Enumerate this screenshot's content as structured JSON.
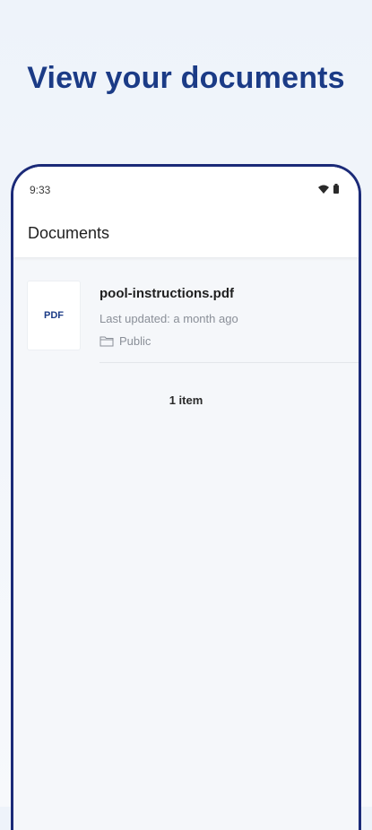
{
  "headline": "View your documents",
  "status_bar": {
    "time": "9:33",
    "wifi_icon": "wifi-icon",
    "battery_icon": "battery-icon"
  },
  "app_bar": {
    "title": "Documents"
  },
  "documents": [
    {
      "thumb_label": "PDF",
      "name": "pool-instructions.pdf",
      "last_updated": "Last updated: a month ago",
      "folder_icon": "folder-icon",
      "folder": "Public"
    }
  ],
  "item_count": "1 item",
  "colors": {
    "headline": "#1b3b86",
    "phone_border": "#1b2a78",
    "background": "#eef3fa"
  }
}
